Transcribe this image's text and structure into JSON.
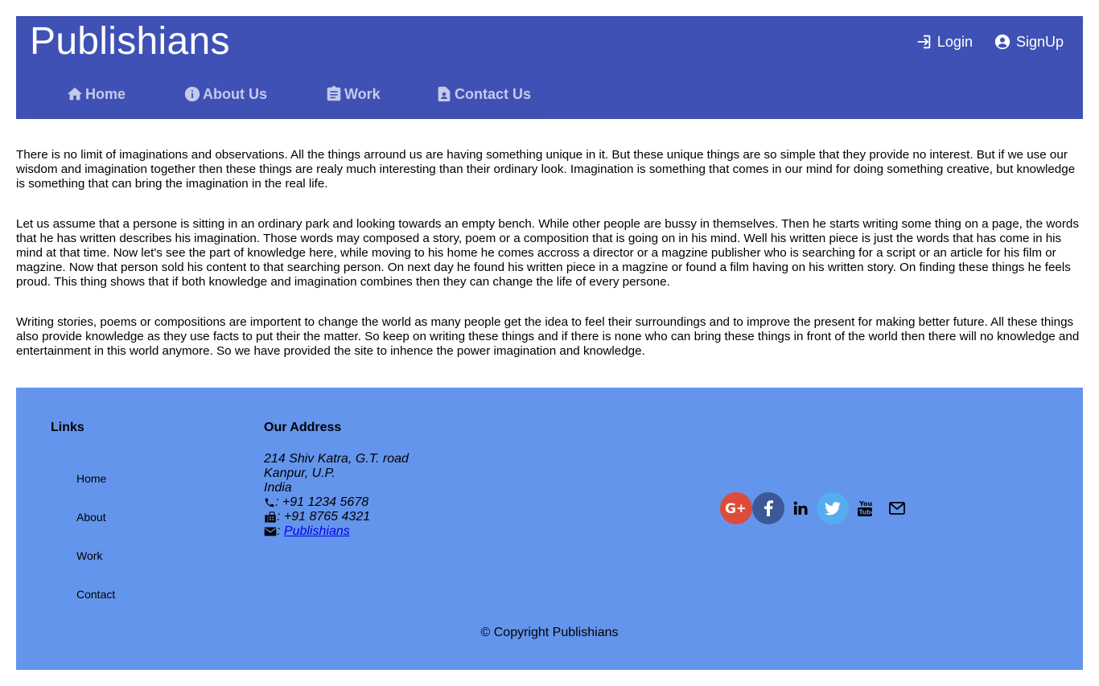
{
  "header": {
    "brand": "Publishians",
    "auth": {
      "login": "Login",
      "signup": "SignUp"
    },
    "nav": [
      "Home",
      "About Us",
      "Work",
      "Contact Us"
    ]
  },
  "content": {
    "paragraphs": [
      "There is no limit of imaginations and observations. All the things arround us are having something unique in it. But these unique things are so simple that they provide no interest. But if we use our wisdom and imagination together then these things are realy much interesting than their ordinary look. Imagination is something that comes in our mind for doing something creative, but knowledge is something that can bring the imagination in the real life.",
      "Let us assume that a persone is sitting in an ordinary park and looking towards an empty bench. While other people are bussy in themselves. Then he starts writing some thing on a page, the words that he has written describes his imagination. Those words may composed a story, poem or a composition that is going on in his mind. Well his written piece is just the words that has come in his mind at that time. Now let's see the part of knowledge here, while moving to his home he comes accross a director or a magzine publisher who is searching for a script or an article for his film or magzine. Now that person sold his content to that searching person. On next day he found his written piece in a magzine or found a film having on his written story. On finding these things he feels proud. This thing shows that if both knowledge and imagination combines then they can change the life of every persone.",
      "Writing stories, poems or compositions are importent to change the world as many people get the idea to feel their surroundings and to improve the present for making better future. All these things also provide knowledge as they use facts to put their the matter. So keep on writing these things and if there is none who can bring these things in front of the world then there will no knowledge and entertainment in this world anymore. So we have provided the site to inhence the power imagination and knowledge."
    ]
  },
  "footer": {
    "links_heading": "Links",
    "links": [
      "Home",
      "About",
      "Work",
      "Contact"
    ],
    "address_heading": "Our Address",
    "address_lines": [
      "214 Shiv Katra, G.T. road",
      "Kanpur, U.P.",
      "India"
    ],
    "phone": ": +91 1234 5678",
    "fax": ": +91 8765 4321",
    "email_prefix": ":",
    "email_link": "Publishians",
    "copyright": "© Copyright Publishians"
  },
  "colors": {
    "header_bg": "#3f51b5",
    "footer_bg": "#6495ed",
    "google": "#dd4b39",
    "facebook": "#3b5998",
    "twitter": "#55acee"
  },
  "icons": {
    "auth": [
      "login-icon",
      "account-circle-icon"
    ],
    "nav": [
      "home-icon",
      "info-icon",
      "clipboard-icon",
      "contact-card-icon"
    ],
    "contact": [
      "phone-icon",
      "fax-icon",
      "envelope-icon"
    ],
    "social": [
      "google-plus-icon",
      "facebook-icon",
      "linkedin-icon",
      "twitter-icon",
      "youtube-icon",
      "mail-icon"
    ]
  }
}
